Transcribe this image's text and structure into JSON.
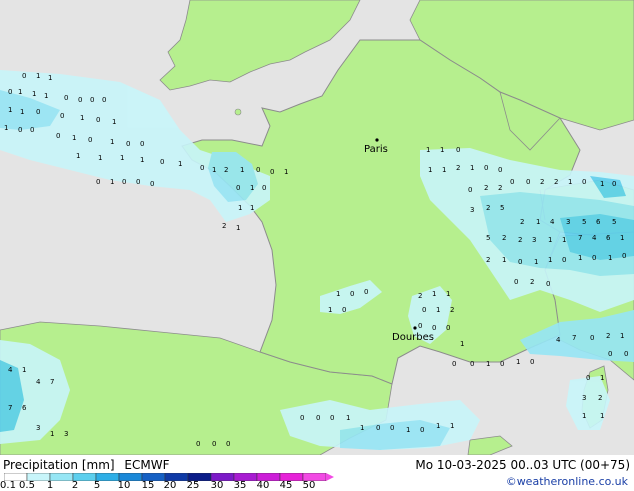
{
  "legend": {
    "title": "Precipitation [mm]",
    "model": "ECMWF",
    "datetime": "Mo 10-03-2025 00..03 UTC (00+75)",
    "credit": "©weatheronline.co.uk",
    "scale_labels": [
      "0.1",
      "0.5",
      "1",
      "2",
      "5",
      "10",
      "15",
      "20",
      "25",
      "30",
      "35",
      "40",
      "45",
      "50"
    ],
    "scale_colors": [
      "#ffffff",
      "#c8f5fa",
      "#96e6f5",
      "#5ccfee",
      "#2eaee6",
      "#1a88d8",
      "#1560c4",
      "#0f3aa6",
      "#0b1c88",
      "#7c1ac8",
      "#a81cd2",
      "#cc1ed8",
      "#e622d8",
      "#f24ae4"
    ]
  },
  "map": {
    "cities": [
      {
        "name": "Paris"
      },
      {
        "name": "Dourbes"
      }
    ],
    "colors": {
      "land": "#b6ef8e",
      "sea_and_foreign": "#e4e4e4",
      "border": "#8c8c8c",
      "precip_light": "#c8f5fa",
      "precip_medium": "#96e6f5",
      "precip_heavy": "#5ccfee"
    },
    "station_values": [
      {
        "v": "0"
      },
      {
        "v": "1"
      },
      {
        "v": "1"
      },
      {
        "v": "0"
      },
      {
        "v": "1"
      },
      {
        "v": "1"
      },
      {
        "v": "1"
      },
      {
        "v": "0"
      },
      {
        "v": "0"
      },
      {
        "v": "0"
      },
      {
        "v": "0"
      },
      {
        "v": "1"
      },
      {
        "v": "1"
      },
      {
        "v": "0"
      },
      {
        "v": "0"
      },
      {
        "v": "1"
      },
      {
        "v": "0"
      },
      {
        "v": "1"
      },
      {
        "v": "1"
      },
      {
        "v": "0"
      },
      {
        "v": "0"
      },
      {
        "v": "0"
      },
      {
        "v": "1"
      },
      {
        "v": "0"
      },
      {
        "v": "1"
      },
      {
        "v": "0"
      },
      {
        "v": "0"
      },
      {
        "v": "1"
      },
      {
        "v": "1"
      },
      {
        "v": "1"
      },
      {
        "v": "1"
      },
      {
        "v": "0"
      },
      {
        "v": "1"
      },
      {
        "v": "0"
      },
      {
        "v": "1"
      },
      {
        "v": "2"
      },
      {
        "v": "1"
      },
      {
        "v": "0"
      },
      {
        "v": "0"
      },
      {
        "v": "1"
      },
      {
        "v": "0"
      },
      {
        "v": "1"
      },
      {
        "v": "0"
      },
      {
        "v": "0"
      },
      {
        "v": "0"
      },
      {
        "v": "0"
      },
      {
        "v": "1"
      },
      {
        "v": "0"
      },
      {
        "v": "1"
      },
      {
        "v": "1"
      },
      {
        "v": "2"
      },
      {
        "v": "1"
      },
      {
        "v": "1"
      },
      {
        "v": "1"
      },
      {
        "v": "0"
      },
      {
        "v": "1"
      },
      {
        "v": "1"
      },
      {
        "v": "2"
      },
      {
        "v": "1"
      },
      {
        "v": "0"
      },
      {
        "v": "0"
      },
      {
        "v": "0"
      },
      {
        "v": "0"
      },
      {
        "v": "2"
      },
      {
        "v": "2"
      },
      {
        "v": "1"
      },
      {
        "v": "0"
      },
      {
        "v": "0"
      },
      {
        "v": "2"
      },
      {
        "v": "2"
      },
      {
        "v": "1"
      },
      {
        "v": "0"
      },
      {
        "v": "3"
      },
      {
        "v": "2"
      },
      {
        "v": "5"
      },
      {
        "v": "2"
      },
      {
        "v": "1"
      },
      {
        "v": "4"
      },
      {
        "v": "3"
      },
      {
        "v": "5"
      },
      {
        "v": "6"
      },
      {
        "v": "5"
      },
      {
        "v": "5"
      },
      {
        "v": "2"
      },
      {
        "v": "2"
      },
      {
        "v": "3"
      },
      {
        "v": "1"
      },
      {
        "v": "1"
      },
      {
        "v": "7"
      },
      {
        "v": "4"
      },
      {
        "v": "6"
      },
      {
        "v": "1"
      },
      {
        "v": "2"
      },
      {
        "v": "1"
      },
      {
        "v": "0"
      },
      {
        "v": "1"
      },
      {
        "v": "1"
      },
      {
        "v": "0"
      },
      {
        "v": "1"
      },
      {
        "v": "0"
      },
      {
        "v": "1"
      },
      {
        "v": "0"
      },
      {
        "v": "0"
      },
      {
        "v": "2"
      },
      {
        "v": "0"
      },
      {
        "v": "1"
      },
      {
        "v": "0"
      },
      {
        "v": "0"
      },
      {
        "v": "1"
      },
      {
        "v": "0"
      },
      {
        "v": "2"
      },
      {
        "v": "1"
      },
      {
        "v": "1"
      },
      {
        "v": "0"
      },
      {
        "v": "1"
      },
      {
        "v": "2"
      },
      {
        "v": "0"
      },
      {
        "v": "0"
      },
      {
        "v": "0"
      },
      {
        "v": "1"
      },
      {
        "v": "0"
      },
      {
        "v": "0"
      },
      {
        "v": "1"
      },
      {
        "v": "0"
      },
      {
        "v": "1"
      },
      {
        "v": "0"
      },
      {
        "v": "4"
      },
      {
        "v": "7"
      },
      {
        "v": "0"
      },
      {
        "v": "2"
      },
      {
        "v": "1"
      },
      {
        "v": "0"
      },
      {
        "v": "0"
      },
      {
        "v": "0"
      },
      {
        "v": "1"
      },
      {
        "v": "3"
      },
      {
        "v": "2"
      },
      {
        "v": "1"
      },
      {
        "v": "1"
      },
      {
        "v": "4"
      },
      {
        "v": "1"
      },
      {
        "v": "4"
      },
      {
        "v": "7"
      },
      {
        "v": "7"
      },
      {
        "v": "6"
      },
      {
        "v": "3"
      },
      {
        "v": "1"
      },
      {
        "v": "3"
      },
      {
        "v": "0"
      },
      {
        "v": "0"
      },
      {
        "v": "0"
      },
      {
        "v": "1"
      },
      {
        "v": "1"
      },
      {
        "v": "0"
      },
      {
        "v": "0"
      },
      {
        "v": "1"
      },
      {
        "v": "0"
      },
      {
        "v": "1"
      },
      {
        "v": "1"
      },
      {
        "v": "0"
      },
      {
        "v": "0"
      },
      {
        "v": "0"
      },
      {
        "v": "1"
      },
      {
        "v": "0"
      },
      {
        "v": "2"
      },
      {
        "v": "1"
      },
      {
        "v": "0"
      },
      {
        "v": "0"
      }
    ]
  }
}
